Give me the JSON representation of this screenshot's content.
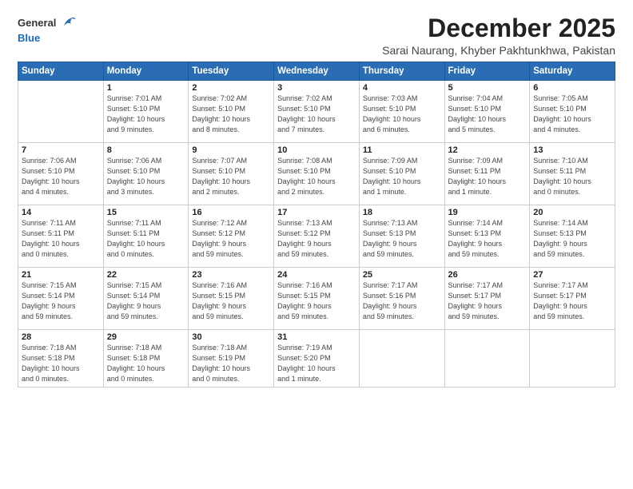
{
  "logo": {
    "general": "General",
    "blue": "Blue"
  },
  "header": {
    "title": "December 2025",
    "subtitle": "Sarai Naurang, Khyber Pakhtunkhwa, Pakistan"
  },
  "weekdays": [
    "Sunday",
    "Monday",
    "Tuesday",
    "Wednesday",
    "Thursday",
    "Friday",
    "Saturday"
  ],
  "weeks": [
    [
      {
        "day": "",
        "info": ""
      },
      {
        "day": "1",
        "info": "Sunrise: 7:01 AM\nSunset: 5:10 PM\nDaylight: 10 hours\nand 9 minutes."
      },
      {
        "day": "2",
        "info": "Sunrise: 7:02 AM\nSunset: 5:10 PM\nDaylight: 10 hours\nand 8 minutes."
      },
      {
        "day": "3",
        "info": "Sunrise: 7:02 AM\nSunset: 5:10 PM\nDaylight: 10 hours\nand 7 minutes."
      },
      {
        "day": "4",
        "info": "Sunrise: 7:03 AM\nSunset: 5:10 PM\nDaylight: 10 hours\nand 6 minutes."
      },
      {
        "day": "5",
        "info": "Sunrise: 7:04 AM\nSunset: 5:10 PM\nDaylight: 10 hours\nand 5 minutes."
      },
      {
        "day": "6",
        "info": "Sunrise: 7:05 AM\nSunset: 5:10 PM\nDaylight: 10 hours\nand 4 minutes."
      }
    ],
    [
      {
        "day": "7",
        "info": "Sunrise: 7:06 AM\nSunset: 5:10 PM\nDaylight: 10 hours\nand 4 minutes."
      },
      {
        "day": "8",
        "info": "Sunrise: 7:06 AM\nSunset: 5:10 PM\nDaylight: 10 hours\nand 3 minutes."
      },
      {
        "day": "9",
        "info": "Sunrise: 7:07 AM\nSunset: 5:10 PM\nDaylight: 10 hours\nand 2 minutes."
      },
      {
        "day": "10",
        "info": "Sunrise: 7:08 AM\nSunset: 5:10 PM\nDaylight: 10 hours\nand 2 minutes."
      },
      {
        "day": "11",
        "info": "Sunrise: 7:09 AM\nSunset: 5:10 PM\nDaylight: 10 hours\nand 1 minute."
      },
      {
        "day": "12",
        "info": "Sunrise: 7:09 AM\nSunset: 5:11 PM\nDaylight: 10 hours\nand 1 minute."
      },
      {
        "day": "13",
        "info": "Sunrise: 7:10 AM\nSunset: 5:11 PM\nDaylight: 10 hours\nand 0 minutes."
      }
    ],
    [
      {
        "day": "14",
        "info": "Sunrise: 7:11 AM\nSunset: 5:11 PM\nDaylight: 10 hours\nand 0 minutes."
      },
      {
        "day": "15",
        "info": "Sunrise: 7:11 AM\nSunset: 5:11 PM\nDaylight: 10 hours\nand 0 minutes."
      },
      {
        "day": "16",
        "info": "Sunrise: 7:12 AM\nSunset: 5:12 PM\nDaylight: 9 hours\nand 59 minutes."
      },
      {
        "day": "17",
        "info": "Sunrise: 7:13 AM\nSunset: 5:12 PM\nDaylight: 9 hours\nand 59 minutes."
      },
      {
        "day": "18",
        "info": "Sunrise: 7:13 AM\nSunset: 5:13 PM\nDaylight: 9 hours\nand 59 minutes."
      },
      {
        "day": "19",
        "info": "Sunrise: 7:14 AM\nSunset: 5:13 PM\nDaylight: 9 hours\nand 59 minutes."
      },
      {
        "day": "20",
        "info": "Sunrise: 7:14 AM\nSunset: 5:13 PM\nDaylight: 9 hours\nand 59 minutes."
      }
    ],
    [
      {
        "day": "21",
        "info": "Sunrise: 7:15 AM\nSunset: 5:14 PM\nDaylight: 9 hours\nand 59 minutes."
      },
      {
        "day": "22",
        "info": "Sunrise: 7:15 AM\nSunset: 5:14 PM\nDaylight: 9 hours\nand 59 minutes."
      },
      {
        "day": "23",
        "info": "Sunrise: 7:16 AM\nSunset: 5:15 PM\nDaylight: 9 hours\nand 59 minutes."
      },
      {
        "day": "24",
        "info": "Sunrise: 7:16 AM\nSunset: 5:15 PM\nDaylight: 9 hours\nand 59 minutes."
      },
      {
        "day": "25",
        "info": "Sunrise: 7:17 AM\nSunset: 5:16 PM\nDaylight: 9 hours\nand 59 minutes."
      },
      {
        "day": "26",
        "info": "Sunrise: 7:17 AM\nSunset: 5:17 PM\nDaylight: 9 hours\nand 59 minutes."
      },
      {
        "day": "27",
        "info": "Sunrise: 7:17 AM\nSunset: 5:17 PM\nDaylight: 9 hours\nand 59 minutes."
      }
    ],
    [
      {
        "day": "28",
        "info": "Sunrise: 7:18 AM\nSunset: 5:18 PM\nDaylight: 10 hours\nand 0 minutes."
      },
      {
        "day": "29",
        "info": "Sunrise: 7:18 AM\nSunset: 5:18 PM\nDaylight: 10 hours\nand 0 minutes."
      },
      {
        "day": "30",
        "info": "Sunrise: 7:18 AM\nSunset: 5:19 PM\nDaylight: 10 hours\nand 0 minutes."
      },
      {
        "day": "31",
        "info": "Sunrise: 7:19 AM\nSunset: 5:20 PM\nDaylight: 10 hours\nand 1 minute."
      },
      {
        "day": "",
        "info": ""
      },
      {
        "day": "",
        "info": ""
      },
      {
        "day": "",
        "info": ""
      }
    ]
  ]
}
